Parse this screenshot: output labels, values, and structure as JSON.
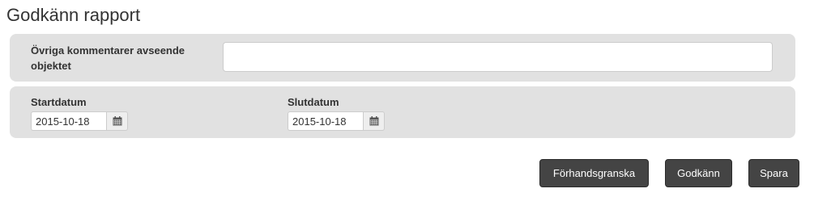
{
  "page": {
    "title": "Godkänn rapport"
  },
  "comments": {
    "label": "Övriga kommentarer avseende objektet",
    "value": "",
    "placeholder": ""
  },
  "dates": {
    "start": {
      "label": "Startdatum",
      "value": "2015-10-18",
      "icon": "calendar-icon"
    },
    "end": {
      "label": "Slutdatum",
      "value": "2015-10-18",
      "icon": "calendar-icon"
    }
  },
  "actions": {
    "preview_label": "Förhandsgranska",
    "approve_label": "Godkänn",
    "save_label": "Spara"
  },
  "colors": {
    "panel_bg": "#e1e1e1",
    "button_bg": "#444444",
    "button_text": "#ffffff"
  }
}
